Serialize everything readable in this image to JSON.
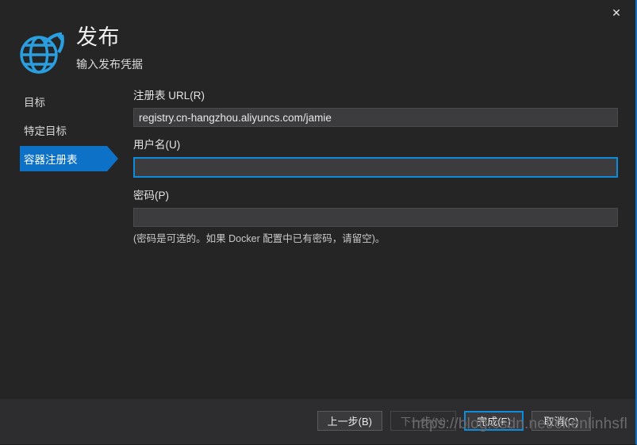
{
  "window": {
    "close_label": "✕",
    "accent_color": "#0d72c7",
    "background_color": "#252526",
    "footer_color": "#2d2d30"
  },
  "header": {
    "icon": "globe-publish-icon",
    "title": "发布",
    "subtitle": "输入发布凭据"
  },
  "sidebar": {
    "items": [
      {
        "label": "目标",
        "selected": false
      },
      {
        "label": "特定目标",
        "selected": false
      },
      {
        "label": "容器注册表",
        "selected": true
      }
    ]
  },
  "form": {
    "registry_url": {
      "label": "注册表 URL(R)",
      "value": "registry.cn-hangzhou.aliyuncs.com/jamie",
      "placeholder": ""
    },
    "username": {
      "label": "用户名(U)",
      "value": "",
      "placeholder": "",
      "focused": true
    },
    "password": {
      "label": "密码(P)",
      "value": "",
      "placeholder": ""
    },
    "password_hint": "(密码是可选的。如果 Docker 配置中已有密码，请留空)。"
  },
  "footer": {
    "buttons": [
      {
        "label": "上一步(B)",
        "state": "enabled"
      },
      {
        "label": "下一步(N)",
        "state": "disabled"
      },
      {
        "label": "完成(F)",
        "state": "default"
      },
      {
        "label": "取消(C)",
        "state": "enabled"
      }
    ]
  },
  "watermark": {
    "text": "https://blog.csdn.net/chenlinhsfl"
  }
}
